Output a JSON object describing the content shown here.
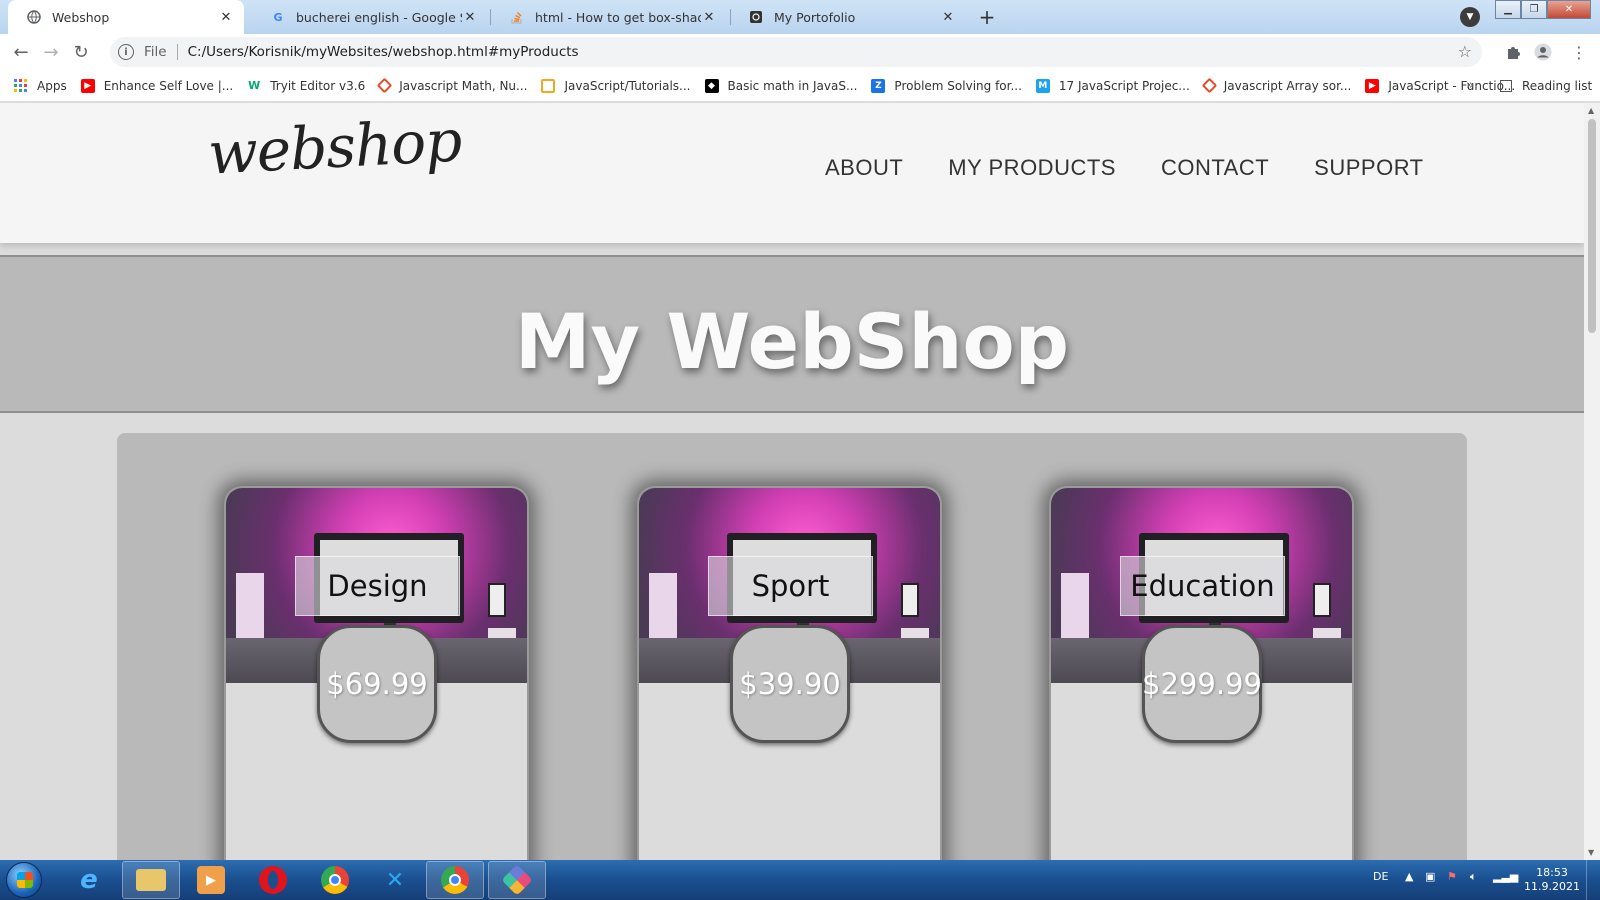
{
  "browser": {
    "tabs": [
      {
        "label": "Webshop",
        "icon": "globe-icon",
        "active": true
      },
      {
        "label": "bucherei english - Google Search",
        "icon": "google-icon",
        "active": false
      },
      {
        "label": "html - How to get box-shadow o",
        "icon": "stackoverflow-icon",
        "active": false
      },
      {
        "label": "My Portofolio",
        "icon": "github-icon",
        "active": false
      }
    ],
    "new_tab": "+",
    "address": {
      "scheme_label": "File",
      "url": "C:/Users/Korisnik/myWebsites/webshop.html#myProducts"
    },
    "bookmarks": [
      {
        "label": "Apps",
        "icon": "apps-grid-icon",
        "color": "#4285f4"
      },
      {
        "label": "Enhance Self Love |...",
        "icon": "youtube-icon",
        "color": "#ff0000"
      },
      {
        "label": "Tryit Editor v3.6",
        "icon": "w3schools-icon",
        "color": "#04aa6d"
      },
      {
        "label": "Javascript Math, Nu...",
        "icon": "w3resource-icon",
        "color": "#e34c26"
      },
      {
        "label": "JavaScript/Tutorials...",
        "icon": "tutorial-icon",
        "color": "#f5a623"
      },
      {
        "label": "Basic math in JavaS...",
        "icon": "mdn-icon",
        "color": "#000000"
      },
      {
        "label": "Problem Solving for...",
        "icon": "blog-icon",
        "color": "#1a73e8"
      },
      {
        "label": "17 JavaScript Projec...",
        "icon": "medium-icon",
        "color": "#1da1f2"
      },
      {
        "label": "Javascript Array sor...",
        "icon": "w3resource-icon",
        "color": "#e34c26"
      },
      {
        "label": "JavaScript - Functio...",
        "icon": "youtube-icon",
        "color": "#ff0000"
      }
    ],
    "more_bookmarks": "»",
    "reading_list": "Reading list"
  },
  "site": {
    "logo": "webshop",
    "nav": [
      "ABOUT",
      "MY PRODUCTS",
      "CONTACT",
      "SUPPORT"
    ],
    "hero_title": "My WebShop",
    "products": [
      {
        "name": "Design",
        "price": "$69.99"
      },
      {
        "name": "Sport",
        "price": "$39.90"
      },
      {
        "name": "Education",
        "price": "$299.99"
      }
    ]
  },
  "taskbar": {
    "apps": [
      "internet-explorer-icon",
      "file-explorer-icon",
      "media-player-icon",
      "opera-icon",
      "chrome-icon",
      "vscode-icon",
      "chrome-icon",
      "app-icon"
    ],
    "language": "DE",
    "time": "18:53",
    "date": "11.9.2021"
  },
  "colors": {
    "accent_pink": "#ff5fd2",
    "page_bg": "#dcdcdc",
    "hero_bg": "#b9b9b9"
  }
}
